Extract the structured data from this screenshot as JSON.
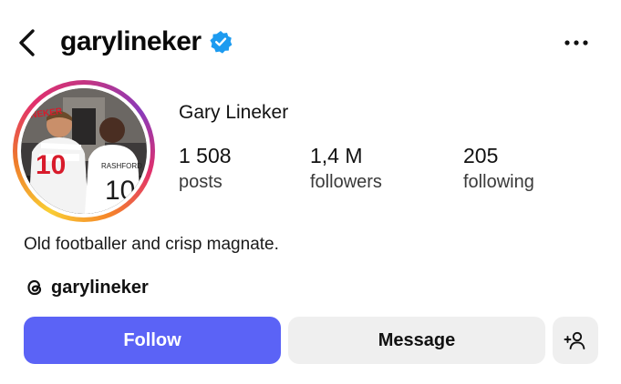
{
  "header": {
    "username": "garylineker",
    "back_icon": "chevron-left-icon",
    "verified_icon": "verified-badge-icon",
    "more_icon": "more-horizontal-icon"
  },
  "profile": {
    "display_name": "Gary Lineker",
    "avatar_shirt_left": "LINEKER",
    "avatar_number_left": "10",
    "avatar_shirt_right": "RASHFORD",
    "avatar_number_right": "10",
    "stats": [
      {
        "value": "1 508",
        "label": "posts"
      },
      {
        "value": "1,4 M",
        "label": "followers"
      },
      {
        "value": "205",
        "label": "following"
      }
    ],
    "bio": "Old footballer and crisp magnate.",
    "threads_handle": "garylineker",
    "threads_icon": "threads-icon"
  },
  "actions": {
    "follow_label": "Follow",
    "message_label": "Message",
    "add_user_icon": "add-person-icon"
  },
  "colors": {
    "follow_bg": "#5b63f6",
    "secondary_bg": "#efefef",
    "verified": "#1d9bf0"
  }
}
